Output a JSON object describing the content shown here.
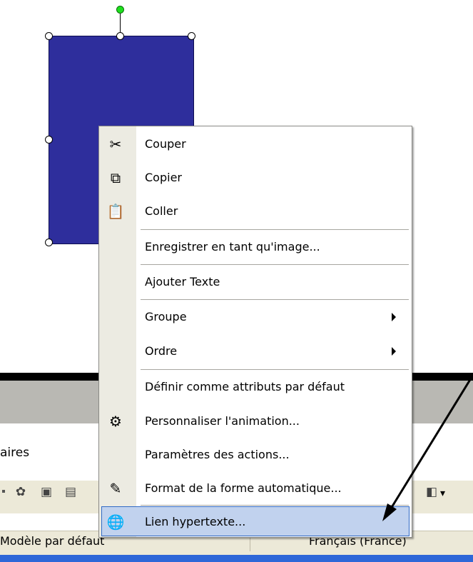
{
  "status_bar": {
    "design": "Modèle par défaut",
    "language": "Français (France)"
  },
  "panel": {
    "tab_label": "aires"
  },
  "context_menu": {
    "items": [
      {
        "label": "Couper",
        "icon": "scissors-icon",
        "submenu": false
      },
      {
        "label": "Copier",
        "icon": "copy-icon",
        "submenu": false
      },
      {
        "label": "Coller",
        "icon": "paste-icon",
        "submenu": false
      },
      {
        "label": "Enregistrer en tant qu'image...",
        "icon": "",
        "submenu": false
      },
      {
        "label": "Ajouter Texte",
        "icon": "",
        "submenu": false
      },
      {
        "label": "Groupe",
        "icon": "",
        "submenu": true
      },
      {
        "label": "Ordre",
        "icon": "",
        "submenu": true
      },
      {
        "label": "Définir comme attributs par défaut",
        "icon": "",
        "submenu": false
      },
      {
        "label": "Personnaliser l'animation...",
        "icon": "animation-icon",
        "submenu": false
      },
      {
        "label": "Paramètres des actions...",
        "icon": "",
        "submenu": false
      },
      {
        "label": "Format de la forme automatique...",
        "icon": "format-shape-icon",
        "submenu": false
      },
      {
        "label": "Lien hypertexte...",
        "icon": "hyperlink-icon",
        "submenu": false
      }
    ],
    "highlighted": "Lien hypertexte..."
  },
  "colors": {
    "shape_fill": "#2e2e9c",
    "menu_highlight": "#c1d2ee",
    "taskbar": "#2e67d8"
  }
}
